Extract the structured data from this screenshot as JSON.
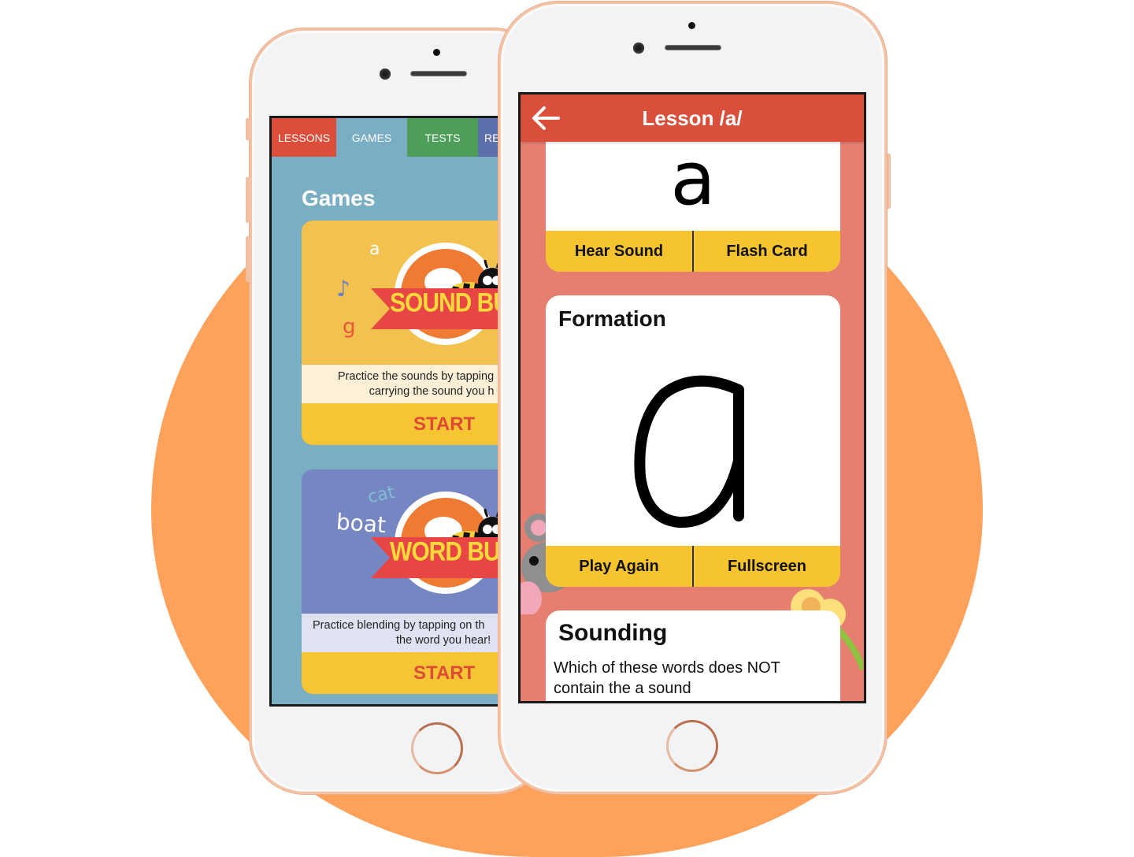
{
  "left_phone": {
    "tabs": [
      {
        "label": "LESSONS",
        "color": "#dc4e3a"
      },
      {
        "label": "GAMES",
        "color": "#79aec4",
        "active": true
      },
      {
        "label": "TESTS",
        "color": "#4c9e58"
      },
      {
        "label": "RE",
        "color": "#5d70ad"
      }
    ],
    "page_title": "Games",
    "games": [
      {
        "name": "SOUND BUZZ",
        "decor_letters": [
          "a",
          "g"
        ],
        "decor_icon": "music-note-icon",
        "description_line1": "Practice the sounds by tapping",
        "description_line2": "carrying the sound you h",
        "start_label": "START"
      },
      {
        "name": "WORD BUZZ",
        "decor_words": [
          "cat",
          "boat"
        ],
        "description_line1": "Practice blending by tapping on th",
        "description_line2": "the word you hear!",
        "start_label": "START"
      }
    ]
  },
  "right_phone": {
    "header": {
      "title": "Lesson /a/",
      "back_icon": "arrow-left-icon"
    },
    "letter_card": {
      "letter": "a",
      "buttons": [
        "Hear Sound",
        "Flash Card"
      ]
    },
    "formation_card": {
      "title": "Formation",
      "letter": "a",
      "buttons": [
        "Play Again",
        "Fullscreen"
      ]
    },
    "sounding_card": {
      "title": "Sounding",
      "question": "Which of these words does NOT contain the a sound"
    }
  },
  "colors": {
    "background_blob": "#fea25b",
    "header_red": "#d94f3b",
    "button_yellow": "#f6c42f",
    "start_red": "#dd4b35"
  }
}
